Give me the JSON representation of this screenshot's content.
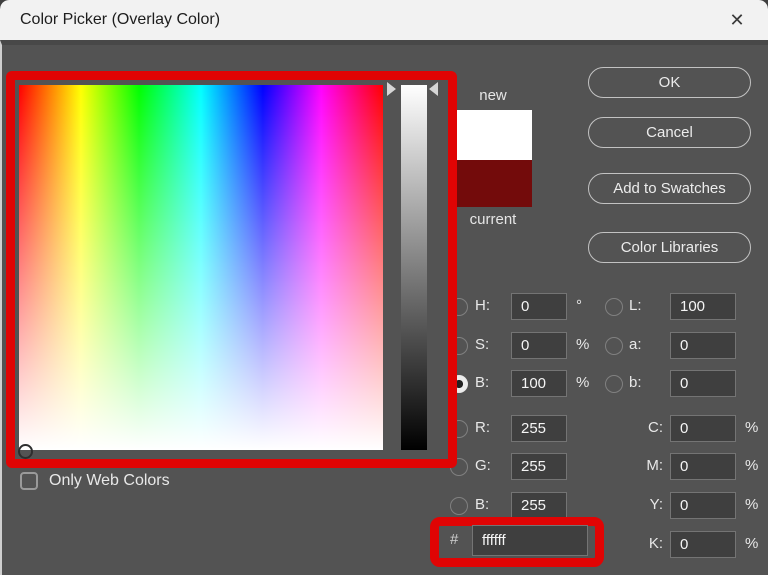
{
  "window": {
    "title": "Color Picker (Overlay Color)"
  },
  "icons": {
    "close": "✕"
  },
  "annotation": {
    "color": "#e00404"
  },
  "swatches": {
    "new_label": "new",
    "current_label": "current",
    "new_color": "#ffffff",
    "current_color": "#730b0b"
  },
  "buttons": {
    "ok": "OK",
    "cancel": "Cancel",
    "add_to_swatches": "Add to Swatches",
    "color_libraries": "Color Libraries"
  },
  "fields": {
    "h": {
      "label": "H:",
      "value": "0",
      "unit": "°"
    },
    "s": {
      "label": "S:",
      "value": "0",
      "unit": "%"
    },
    "b": {
      "label": "B:",
      "value": "100",
      "unit": "%",
      "selected": true
    },
    "r": {
      "label": "R:",
      "value": "255"
    },
    "g": {
      "label": "G:",
      "value": "255"
    },
    "b2": {
      "label": "B:",
      "value": "255"
    },
    "l": {
      "label": "L:",
      "value": "100"
    },
    "a": {
      "label": "a:",
      "value": "0"
    },
    "lab_b": {
      "label": "b:",
      "value": "0"
    },
    "c": {
      "label": "C:",
      "value": "0",
      "unit": "%"
    },
    "m": {
      "label": "M:",
      "value": "0",
      "unit": "%"
    },
    "y": {
      "label": "Y:",
      "value": "0",
      "unit": "%"
    },
    "k": {
      "label": "K:",
      "value": "0",
      "unit": "%"
    },
    "hex": {
      "prefix": "#",
      "value": "ffffff"
    }
  },
  "checkbox": {
    "label": "Only Web Colors",
    "checked": false
  }
}
